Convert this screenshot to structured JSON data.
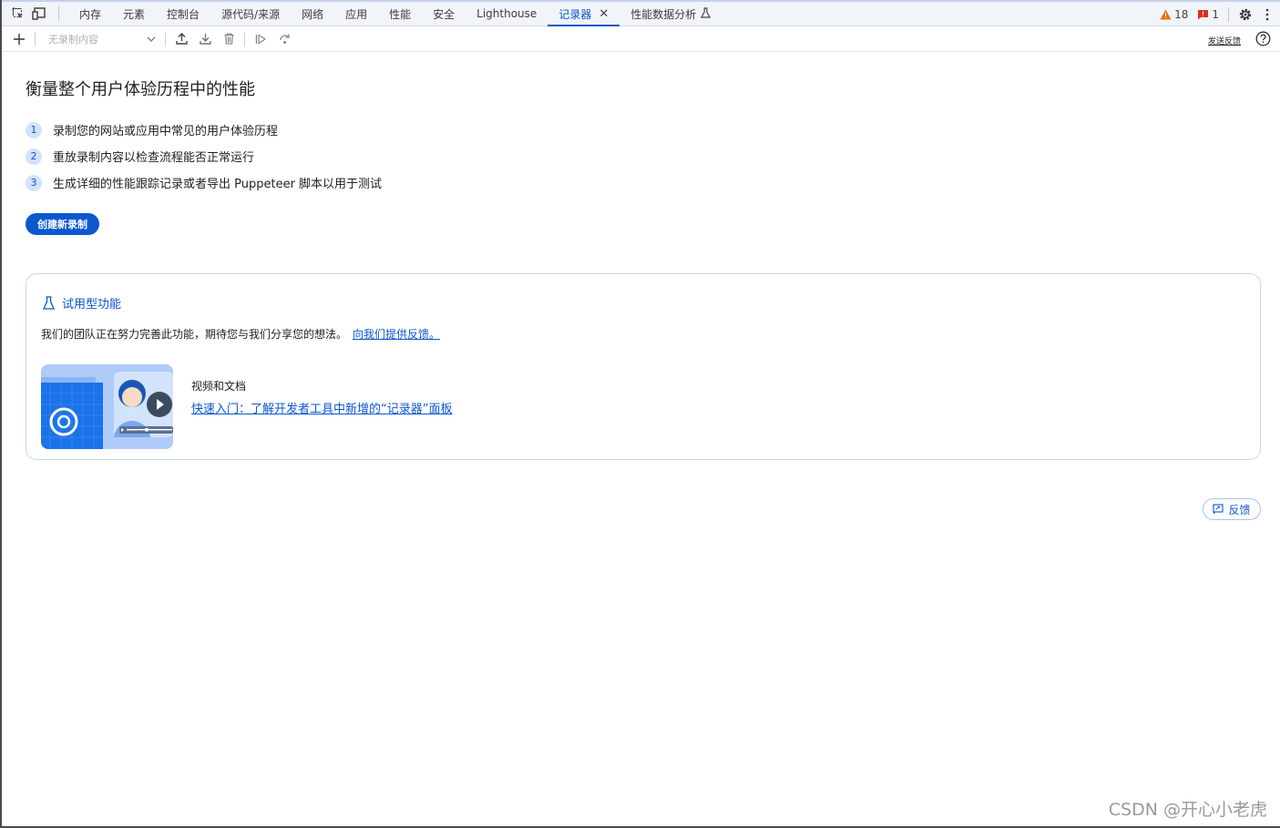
{
  "tabs": [
    {
      "label": "内存",
      "active": false
    },
    {
      "label": "元素",
      "active": false
    },
    {
      "label": "控制台",
      "active": false
    },
    {
      "label": "源代码/来源",
      "active": false
    },
    {
      "label": "网络",
      "active": false
    },
    {
      "label": "应用",
      "active": false
    },
    {
      "label": "性能",
      "active": false
    },
    {
      "label": "安全",
      "active": false
    },
    {
      "label": "Lighthouse",
      "active": false
    },
    {
      "label": "记录器",
      "active": true,
      "closable": true
    },
    {
      "label": "性能数据分析",
      "active": false,
      "experimental": true
    }
  ],
  "status": {
    "warnings": "18",
    "errors": "1"
  },
  "toolbar": {
    "recording_select": "无录制内容",
    "send_feedback": "发送反馈",
    "icons": [
      "add-icon",
      "chevron-down-icon",
      "export-icon",
      "import-icon",
      "delete-icon",
      "replay-icon",
      "replay-step-icon",
      "help-icon"
    ]
  },
  "main": {
    "heading": "衡量整个用户体验历程中的性能",
    "steps": [
      {
        "num": "1",
        "text": "录制您的网站或应用中常见的用户体验历程"
      },
      {
        "num": "2",
        "text": "重放录制内容以检查流程能否正常运行"
      },
      {
        "num": "3",
        "text": "生成详细的性能跟踪记录或者导出 Puppeteer 脚本以用于测试"
      }
    ],
    "create_button": "创建新录制"
  },
  "card": {
    "title": "试用型功能",
    "description": "我们的团队正在努力完善此功能，期待您与我们分享您的想法。",
    "feedback_link": "向我们提供反馈。",
    "video_label": "视频和文档",
    "video_link": "快速入门：了解开发者工具中新增的“记录器”面板"
  },
  "feedback_button": "反馈",
  "watermark": "CSDN @开心小老虎",
  "colors": {
    "accent": "#0b57d0",
    "warning": "#e37400",
    "error": "#d93025"
  }
}
